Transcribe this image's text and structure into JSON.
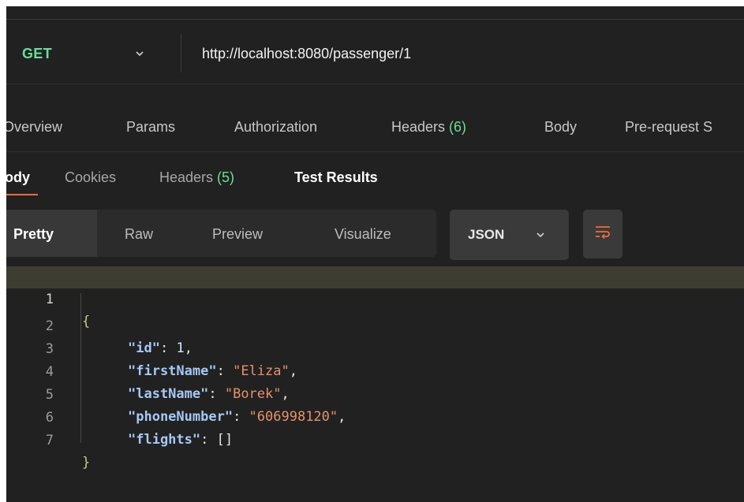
{
  "request": {
    "method": "GET",
    "method_chevron_icon": "chevron-down-icon",
    "url": "http://localhost:8080/passenger/1"
  },
  "request_tabs": [
    {
      "label": "Overview"
    },
    {
      "label": "Params"
    },
    {
      "label": "Authorization"
    },
    {
      "label": "Headers ",
      "count": "(6)"
    },
    {
      "label": "Body"
    },
    {
      "label": "Pre-request S"
    }
  ],
  "response_tabs": [
    {
      "label": "ody",
      "active": true
    },
    {
      "label": "Cookies"
    },
    {
      "label": "Headers ",
      "count": "(5)"
    },
    {
      "label": "Test Results"
    }
  ],
  "view_tabs": [
    "Pretty",
    "Raw",
    "Preview",
    "Visualize"
  ],
  "format": {
    "label": "JSON",
    "chevron_icon": "chevron-down-icon"
  },
  "wrap_icon": "wrap-lines-icon",
  "code": {
    "line_numbers": [
      "1",
      "2",
      "3",
      "4",
      "5",
      "6",
      "7"
    ],
    "open_brace": "{",
    "close_brace": "}",
    "fields": [
      {
        "key": "\"id\"",
        "value": "1",
        "comma": ","
      },
      {
        "key": "\"firstName\"",
        "value": "\"Eliza\"",
        "comma": ","
      },
      {
        "key": "\"lastName\"",
        "value": "\"Borek\"",
        "comma": ","
      },
      {
        "key": "\"phoneNumber\"",
        "value": "\"606998120\"",
        "comma": ","
      },
      {
        "key": "\"flights\"",
        "value": "[]",
        "comma": ""
      }
    ]
  },
  "colors": {
    "background": "#212121",
    "method_green": "#6bdd9a",
    "accent_orange": "#f26b3a",
    "json_key": "#a6c8f5",
    "json_string": "#e8906a"
  }
}
